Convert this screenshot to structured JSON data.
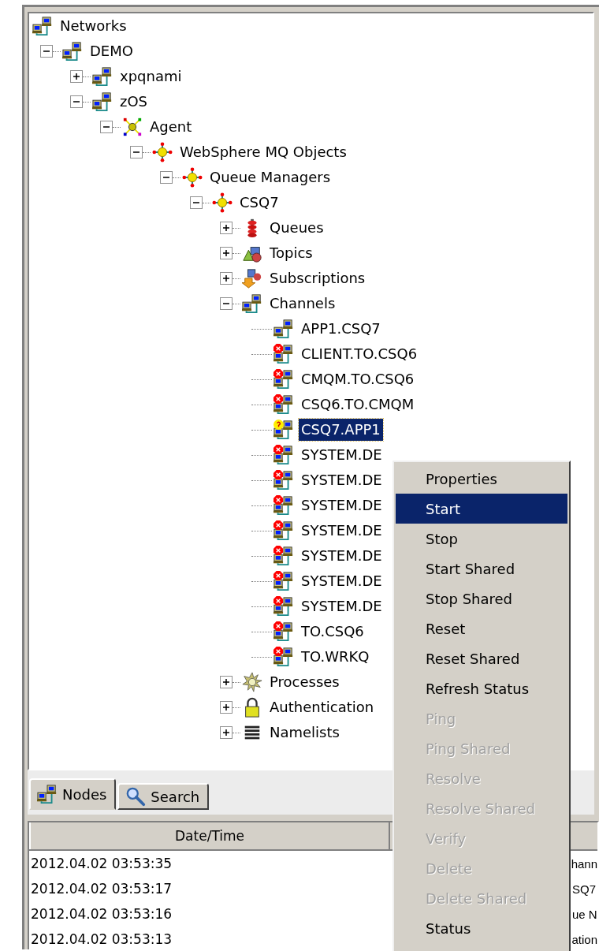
{
  "tree": {
    "nodes": [
      {
        "label": "Networks",
        "kind": "network",
        "selected": false,
        "children": [
          {
            "label": "DEMO",
            "kind": "network",
            "expanded": true,
            "selected": false,
            "children": [
              {
                "label": "xpqnami",
                "kind": "network",
                "expanded": false,
                "selected": false
              },
              {
                "label": "zOS",
                "kind": "network",
                "expanded": true,
                "selected": false,
                "children": [
                  {
                    "label": "Agent",
                    "kind": "agent",
                    "expanded": true,
                    "selected": false,
                    "children": [
                      {
                        "label": "WebSphere MQ Objects",
                        "kind": "mq",
                        "expanded": true,
                        "selected": false,
                        "children": [
                          {
                            "label": "Queue Managers",
                            "kind": "mq",
                            "expanded": true,
                            "selected": false,
                            "children": [
                              {
                                "label": "CSQ7",
                                "kind": "mq",
                                "expanded": true,
                                "selected": false,
                                "children": [
                                  {
                                    "label": "Queues",
                                    "kind": "queue",
                                    "expanded": false,
                                    "selected": false
                                  },
                                  {
                                    "label": "Topics",
                                    "kind": "topic",
                                    "expanded": false,
                                    "selected": false
                                  },
                                  {
                                    "label": "Subscriptions",
                                    "kind": "subscription",
                                    "expanded": false,
                                    "selected": false
                                  },
                                  {
                                    "label": "Channels",
                                    "kind": "network",
                                    "expanded": true,
                                    "selected": false,
                                    "children": [
                                      {
                                        "label": "APP1.CSQ7",
                                        "kind": "channel",
                                        "selected": false
                                      },
                                      {
                                        "label": "CLIENT.TO.CSQ6",
                                        "kind": "channel_stopped",
                                        "selected": false
                                      },
                                      {
                                        "label": "CMQM.TO.CSQ6",
                                        "kind": "channel_stopped",
                                        "selected": false
                                      },
                                      {
                                        "label": "CSQ6.TO.CMQM",
                                        "kind": "channel_stopped",
                                        "selected": false
                                      },
                                      {
                                        "label": "CSQ7.APP1",
                                        "kind": "channel_unknown",
                                        "selected": true
                                      },
                                      {
                                        "label": "SYSTEM.DE",
                                        "kind": "channel_stopped",
                                        "selected": false
                                      },
                                      {
                                        "label": "SYSTEM.DE",
                                        "kind": "channel_stopped",
                                        "selected": false
                                      },
                                      {
                                        "label": "SYSTEM.DE",
                                        "kind": "channel_stopped",
                                        "selected": false
                                      },
                                      {
                                        "label": "SYSTEM.DE",
                                        "kind": "channel_stopped",
                                        "selected": false
                                      },
                                      {
                                        "label": "SYSTEM.DE",
                                        "kind": "channel_stopped",
                                        "selected": false
                                      },
                                      {
                                        "label": "SYSTEM.DE",
                                        "kind": "channel_stopped",
                                        "selected": false
                                      },
                                      {
                                        "label": "SYSTEM.DE",
                                        "kind": "channel_stopped",
                                        "selected": false
                                      },
                                      {
                                        "label": "TO.CSQ6",
                                        "kind": "channel_stopped",
                                        "selected": false
                                      },
                                      {
                                        "label": "TO.WRKQ",
                                        "kind": "channel_stopped",
                                        "selected": false
                                      }
                                    ]
                                  },
                                  {
                                    "label": "Processes",
                                    "kind": "process",
                                    "expanded": false,
                                    "selected": false
                                  },
                                  {
                                    "label": "Authentication",
                                    "kind": "lock",
                                    "expanded": false,
                                    "selected": false
                                  },
                                  {
                                    "label": "Namelists",
                                    "kind": "namelist",
                                    "expanded": false,
                                    "selected": false
                                  }
                                ]
                              }
                            ]
                          }
                        ]
                      }
                    ]
                  }
                ]
              }
            ]
          }
        ]
      }
    ]
  },
  "tabs": [
    {
      "label": "Nodes",
      "kind": "network",
      "selected": true
    },
    {
      "label": "Search",
      "kind": "search",
      "selected": false
    }
  ],
  "table": {
    "columns": [
      {
        "label": "Date/Time"
      }
    ],
    "rows": [
      {
        "date_time": "2012.04.02 03:53:35",
        "column_2": "hann"
      },
      {
        "date_time": "2012.04.02 03:53:17",
        "column_2": "SQ7"
      },
      {
        "date_time": "2012.04.02 03:53:16",
        "column_2": "ue N"
      },
      {
        "date_time": "2012.04.02 03:53:13",
        "column_2": "ation"
      }
    ]
  },
  "context_menu": {
    "items": [
      {
        "label": "Properties",
        "disabled": false,
        "selected": false
      },
      {
        "label": "Start",
        "disabled": false,
        "selected": true
      },
      {
        "label": "Stop",
        "disabled": false,
        "selected": false
      },
      {
        "label": "Start Shared",
        "disabled": false,
        "selected": false
      },
      {
        "label": "Stop Shared",
        "disabled": false,
        "selected": false
      },
      {
        "label": "Reset",
        "disabled": false,
        "selected": false
      },
      {
        "label": "Reset Shared",
        "disabled": false,
        "selected": false
      },
      {
        "label": "Refresh Status",
        "disabled": false,
        "selected": false
      },
      {
        "label": "Ping",
        "disabled": true,
        "selected": false
      },
      {
        "label": "Ping Shared",
        "disabled": true,
        "selected": false
      },
      {
        "label": "Resolve",
        "disabled": true,
        "selected": false
      },
      {
        "label": "Resolve Shared",
        "disabled": true,
        "selected": false
      },
      {
        "label": "Verify",
        "disabled": true,
        "selected": false
      },
      {
        "label": "Delete",
        "disabled": true,
        "selected": false
      },
      {
        "label": "Delete Shared",
        "disabled": true,
        "selected": false
      },
      {
        "label": "Status",
        "disabled": false,
        "selected": false
      }
    ]
  }
}
